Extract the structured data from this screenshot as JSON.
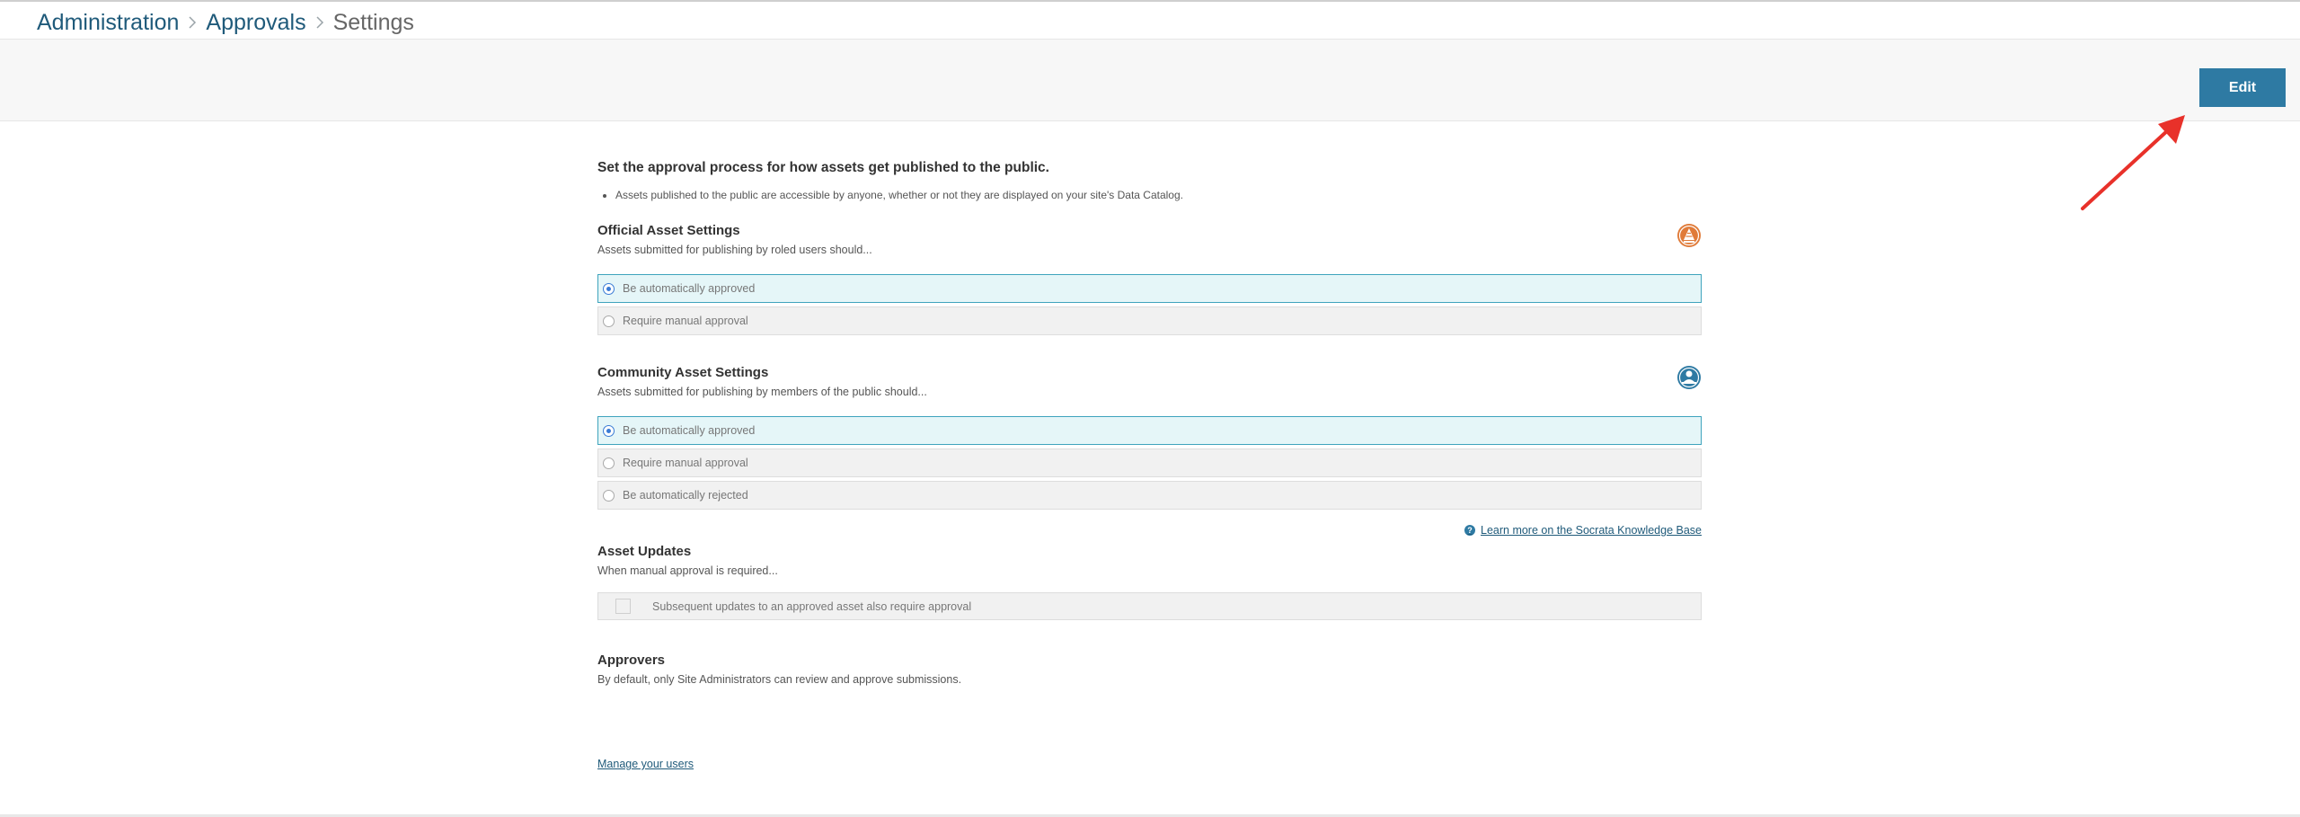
{
  "breadcrumb": {
    "items": [
      "Administration",
      "Approvals"
    ],
    "current": "Settings"
  },
  "toolbar": {
    "edit_label": "Edit"
  },
  "intro": {
    "title": "Set the approval process for how assets get published to the public.",
    "bullet": "Assets published to the public are accessible by anyone, whether or not they are displayed on your site's Data Catalog."
  },
  "official": {
    "title": "Official Asset Settings",
    "description": "Assets submitted for publishing by roled users should...",
    "icon": "official-asset-icon",
    "options": [
      {
        "label": "Be automatically approved",
        "selected": true
      },
      {
        "label": "Require manual approval",
        "selected": false
      }
    ]
  },
  "community": {
    "title": "Community Asset Settings",
    "description": "Assets submitted for publishing by members of the public should...",
    "icon": "community-asset-icon",
    "options": [
      {
        "label": "Be automatically approved",
        "selected": true
      },
      {
        "label": "Require manual approval",
        "selected": false
      },
      {
        "label": "Be automatically rejected",
        "selected": false
      }
    ]
  },
  "knowledge_base": {
    "label": "Learn more on the Socrata Knowledge Base"
  },
  "updates": {
    "title": "Asset Updates",
    "description": "When manual approval is required...",
    "checkbox_label": "Subsequent updates to an approved asset also require approval",
    "checked": false
  },
  "approvers": {
    "title": "Approvers",
    "description": "By default, only Site Administrators can review and approve submissions.",
    "manage_label": "Manage your users"
  },
  "colors": {
    "accent": "#2e7aa3",
    "link": "#1f5a7a",
    "official_icon": "#e07b39",
    "community_icon": "#2e7aa3",
    "selected_bg": "#e5f6f8",
    "arrow": "#e8312a"
  }
}
